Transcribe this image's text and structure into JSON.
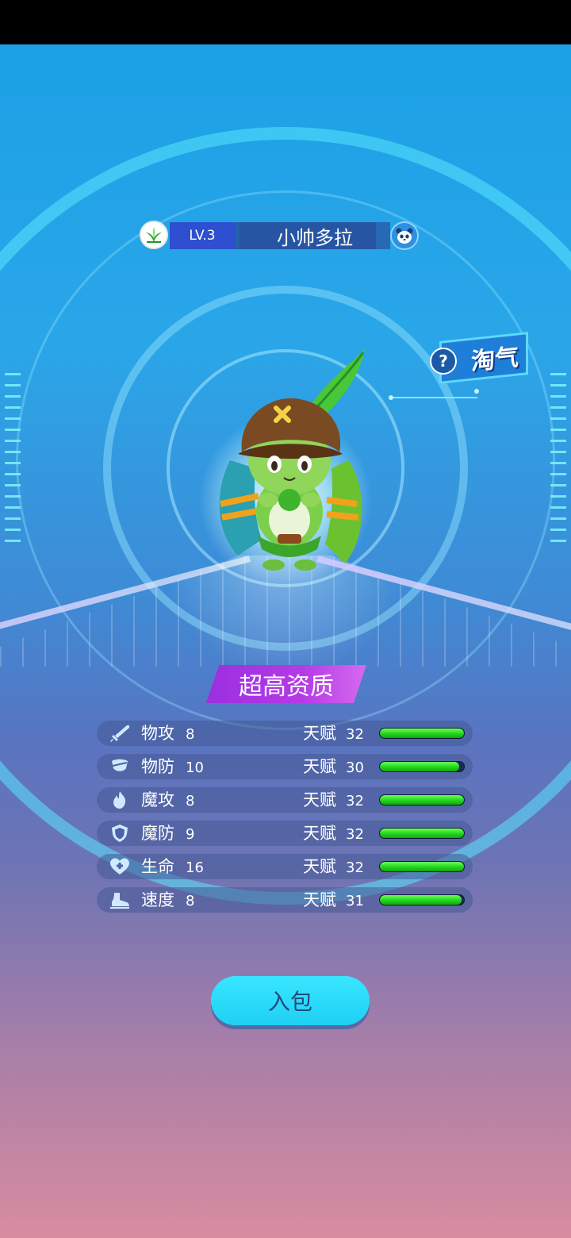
{
  "pet": {
    "level": "LV.3",
    "name": "小帅多拉",
    "element_icon": "leaf-icon",
    "pet_icon": "panda-icon"
  },
  "personality": {
    "help_icon": "question-icon",
    "label": "淘气"
  },
  "quality": {
    "label": "超高资质"
  },
  "stats": [
    {
      "icon": "sword-icon",
      "name": "物攻",
      "value": "8",
      "talent_label": "天赋",
      "talent_value": "32",
      "talent_fill": 1.0
    },
    {
      "icon": "armor-icon",
      "name": "物防",
      "value": "10",
      "talent_label": "天赋",
      "talent_value": "30",
      "talent_fill": 0.94
    },
    {
      "icon": "flame-icon",
      "name": "魔攻",
      "value": "8",
      "talent_label": "天赋",
      "talent_value": "32",
      "talent_fill": 1.0
    },
    {
      "icon": "shield-icon",
      "name": "魔防",
      "value": "9",
      "talent_label": "天赋",
      "talent_value": "32",
      "talent_fill": 1.0
    },
    {
      "icon": "heart-plus-icon",
      "name": "生命",
      "value": "16",
      "talent_label": "天赋",
      "talent_value": "32",
      "talent_fill": 1.0
    },
    {
      "icon": "boot-icon",
      "name": "速度",
      "value": "8",
      "talent_label": "天赋",
      "talent_value": "31",
      "talent_fill": 0.97
    }
  ],
  "actions": {
    "bag_label": "入包"
  },
  "colors": {
    "quality_purple": "#b53ae6",
    "bar_green": "#22d41c",
    "button_cyan": "#1fd0f4",
    "level_blue": "#2e4fd0"
  }
}
